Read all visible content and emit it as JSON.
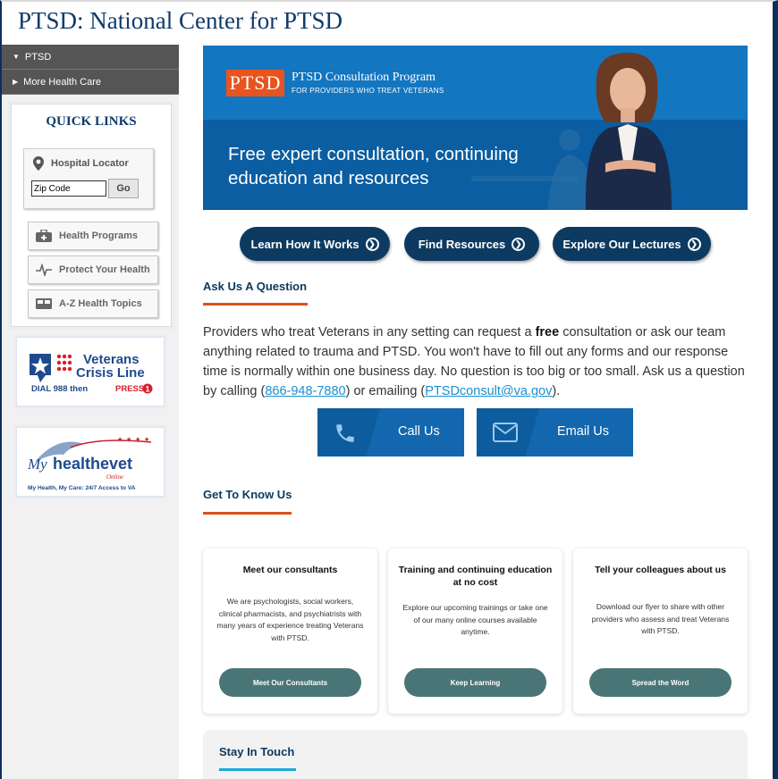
{
  "site": {
    "title": "PTSD: National Center for PTSD"
  },
  "nav": {
    "items": [
      {
        "label": "PTSD",
        "icon": "caret-down"
      },
      {
        "label": "More Health Care",
        "icon": "caret-right"
      }
    ]
  },
  "quick_links": {
    "title": "QUICK LINKS",
    "hospital_locator": {
      "label": "Hospital Locator",
      "zip_value": "Zip Code",
      "go_label": "Go"
    },
    "buttons": [
      {
        "label": "Health Programs",
        "icon": "medkit-icon"
      },
      {
        "label": "Protect Your Health",
        "icon": "pulse-icon"
      },
      {
        "label": "A-Z Health Topics",
        "icon": "book-icon"
      }
    ]
  },
  "banners": {
    "crisis": {
      "line1": "Veterans",
      "line2": "Crisis Line",
      "line3a": "DIAL 988 then ",
      "line3b": "PRESS",
      "line3c": "1"
    },
    "mhv": {
      "brand_my": "My",
      "brand_main": "healthevet",
      "tagline": "My Health, My Care: 24/7 Access to VA",
      "online": "Online"
    }
  },
  "hero": {
    "logo": "PTSD",
    "program": "PTSD Consultation Program",
    "sub": "FOR PROVIDERS WHO TREAT VETERANS",
    "headline": "Free expert consultation, continuing education and resources"
  },
  "actions": [
    {
      "label": "Learn How It Works"
    },
    {
      "label": "Find Resources"
    },
    {
      "label": "Explore Our Lectures"
    }
  ],
  "ask": {
    "title": "Ask Us A Question",
    "p1": "Providers who treat Veterans in any setting can request a ",
    "p_bold": "free",
    "p2": " consultation or ask our team anything related to trauma and PTSD. You won't have to fill out any forms and our response time is normally within one business day. No question is too big or too small. Ask us a question by calling (",
    "phone": "866-948-7880",
    "p3": ") or emailing (",
    "email": "PTSDconsult@va.gov",
    "p4": ").",
    "call_label": "Call Us",
    "email_label": "Email Us"
  },
  "get_to_know": {
    "title": "Get To Know Us",
    "cards": [
      {
        "title": "Meet our consultants",
        "text": "We are psychologists, social workers, clinical pharmacists, and psychiatrists with many years of experience treating Veterans with PTSD.",
        "button": "Meet Our Consultants"
      },
      {
        "title": "Training and continuing education at no cost",
        "text": "Explore our upcoming trainings or take one of our many online courses available anytime.",
        "button": "Keep Learning"
      },
      {
        "title": "Tell your colleagues about us",
        "text": "Download our flyer to share with other providers who assess and treat Veterans with PTSD.",
        "button": "Spread the Word"
      }
    ]
  },
  "stay": {
    "title": "Stay In Touch"
  },
  "colors": {
    "navy": "#0d3a60",
    "orange": "#d6521c",
    "blue": "#1376c0",
    "teal_btn": "#4a7576",
    "stay_line": "#1aa9d6"
  }
}
